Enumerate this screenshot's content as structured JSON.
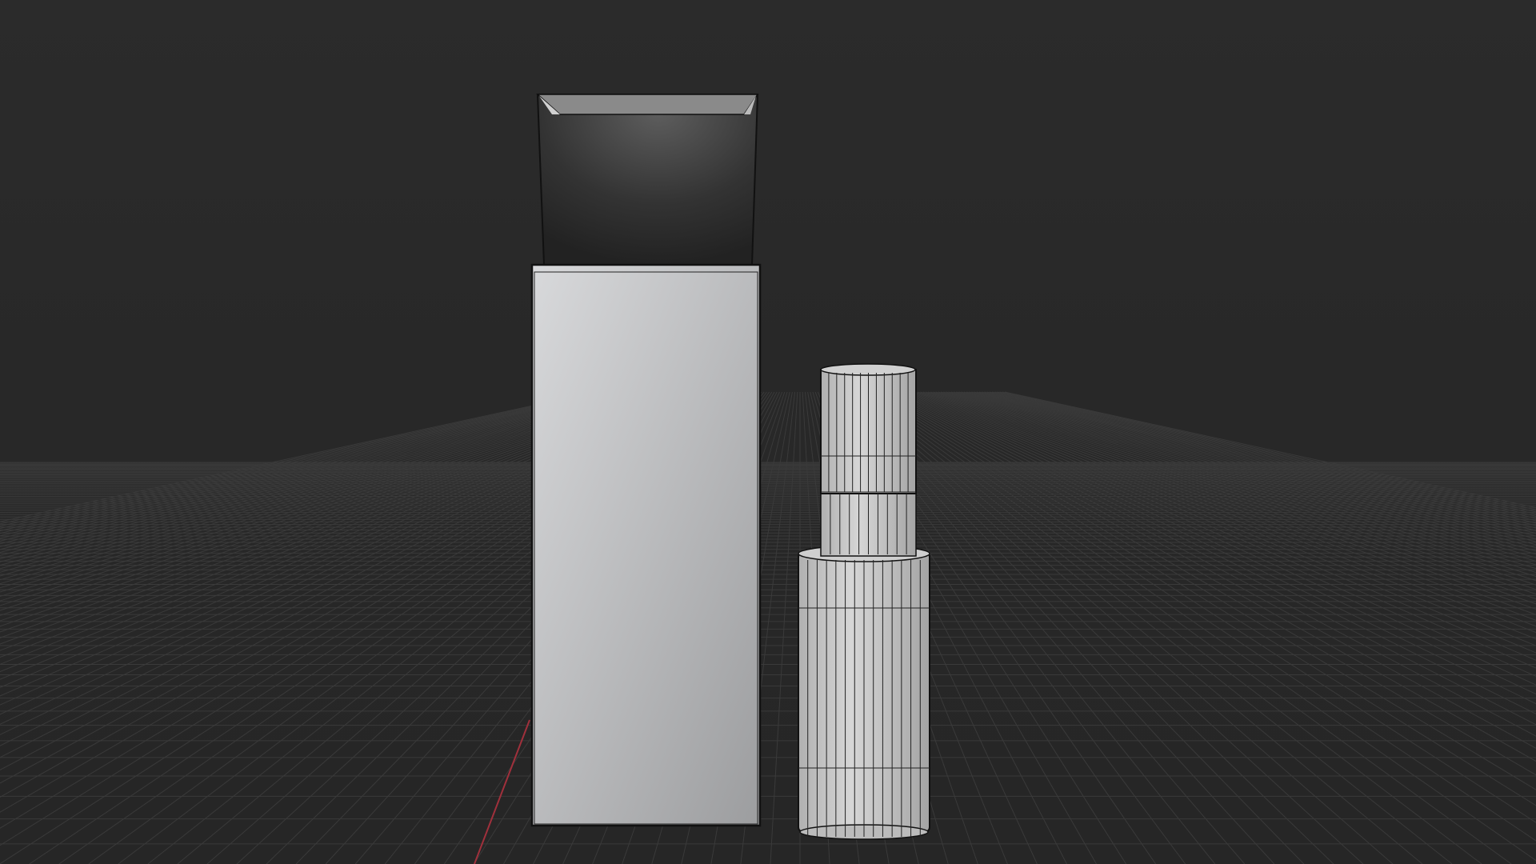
{
  "viewport": {
    "background": "#282828",
    "grid_color": "#3a3a3a",
    "x_axis_color": "#a0303c"
  },
  "objects": [
    {
      "name": "box-sleeve",
      "color": "#b8b9bb"
    },
    {
      "name": "box-inner-tray",
      "color": "#3a3a3a"
    },
    {
      "name": "bottle-cap",
      "color": "#c8c8c8"
    },
    {
      "name": "bottle-body",
      "color": "#c4c4c4"
    }
  ]
}
